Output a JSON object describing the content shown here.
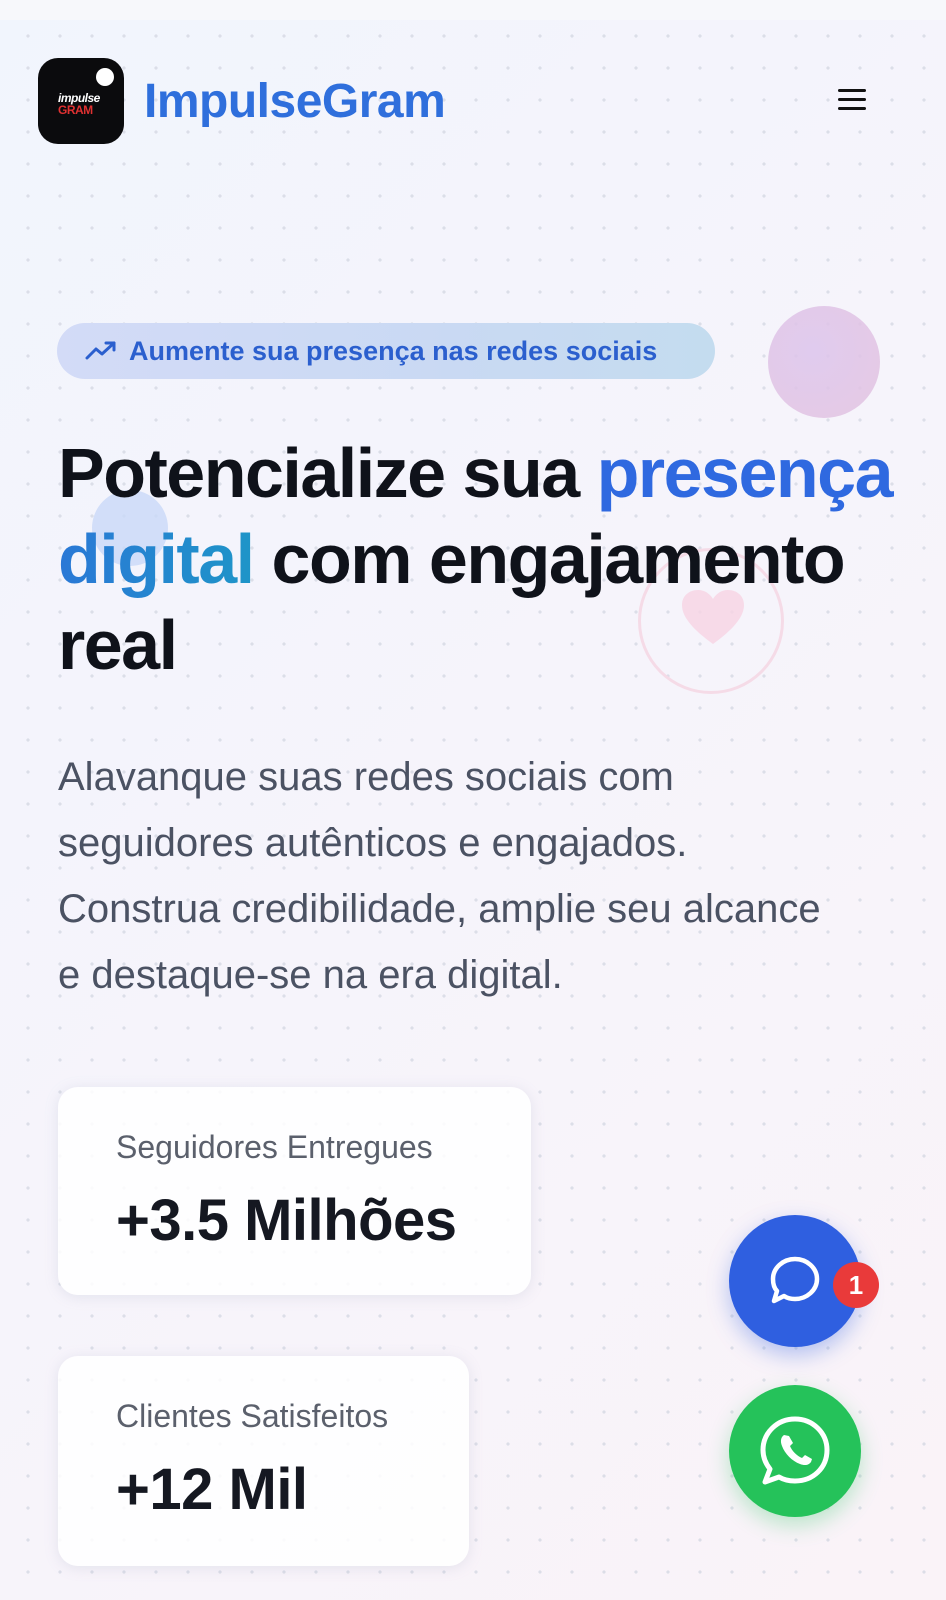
{
  "header": {
    "logo_text_line1": "impulse",
    "logo_text_line2": "GRAM",
    "brand": "ImpulseGram",
    "menu_icon": "hamburger-menu-icon"
  },
  "hero": {
    "badge": "Aumente sua presença nas redes sociais",
    "badge_icon": "trending-up-icon",
    "headline_part1": "Potencialize sua ",
    "headline_highlight1": "presença",
    "headline_highlight2": "digital",
    "headline_part2": " com engajamento real",
    "description": "Alavanque suas redes sociais com seguidores autênticos e engajados. Construa credibilidade, amplie seu alcance e destaque-se na era digital."
  },
  "stats": [
    {
      "label": "Seguidores Entregues",
      "value": "+3.5 Milhões"
    },
    {
      "label": "Clientes Satisfeitos",
      "value": "+12 Mil"
    }
  ],
  "floating": {
    "chat_icon": "chat-bubble-icon",
    "notification_count": "1",
    "whatsapp_icon": "whatsapp-icon"
  },
  "colors": {
    "brand_blue": "#2f6fdc",
    "headline_blue": "#2f69e0",
    "chat_blue": "#2f5fe0",
    "whatsapp_green": "#25c25a",
    "notification_red": "#e93a3a"
  }
}
